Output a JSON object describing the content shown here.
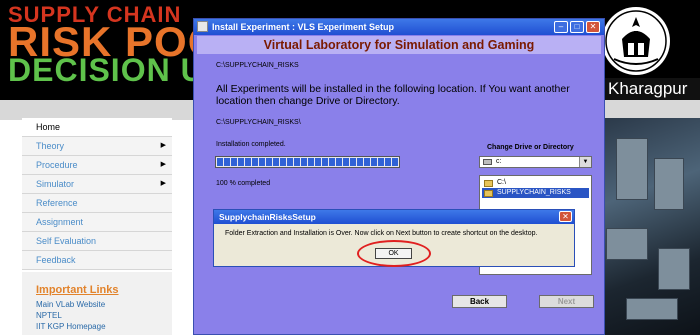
{
  "site": {
    "header_line1": "SUPPLY CHAIN",
    "header_line2": "RISK POOL",
    "header_line3": "DECISION USING",
    "institute_text": "Kharagpur",
    "nav_items": [
      "Home",
      "Theory",
      "Procedure",
      "Simulator",
      "Reference",
      "Assignment",
      "Self Evaluation",
      "Feedback"
    ],
    "links_title": "Important Links",
    "links": [
      "Main VLab Website",
      "NPTEL",
      "IIT KGP Homepage"
    ]
  },
  "installer": {
    "title": "Install Experiment  : VLS Experiment Setup",
    "banner": "Virtual Laboratory for Simulation and Gaming",
    "path_top": "C:\\SUPPLYCHAIN_RISKS",
    "info_message": "All Experiments will be installed in the following location. If You want another location then change Drive or Directory.",
    "path_mid": "C:\\SUPPLYCHAIN_RISKS\\",
    "status": "Installation completed.",
    "progress": 1.0,
    "percent_text": "100 % completed",
    "drive_label": "Change Drive or Directory",
    "drive_value": "c:",
    "dirs": [
      "C:\\",
      "SUPPLYCHAIN_RISKS"
    ],
    "back_label": "Back",
    "next_label": "Next",
    "minimize_glyph": "–",
    "maximize_glyph": "□",
    "close_glyph": "✕"
  },
  "dialog": {
    "title": "SupplychainRisksSetup",
    "message": "Folder Extraction and Installation is Over. Now click on Next button to create shortcut on the desktop.",
    "ok_label": "OK",
    "close_glyph": "✕"
  },
  "colors": {
    "window_bg": "#8a80ea",
    "banner_text": "#7a1a00",
    "titlebar": "#1f4fd2",
    "highlight_circle": "#e02020",
    "links_title": "#e2832b"
  }
}
